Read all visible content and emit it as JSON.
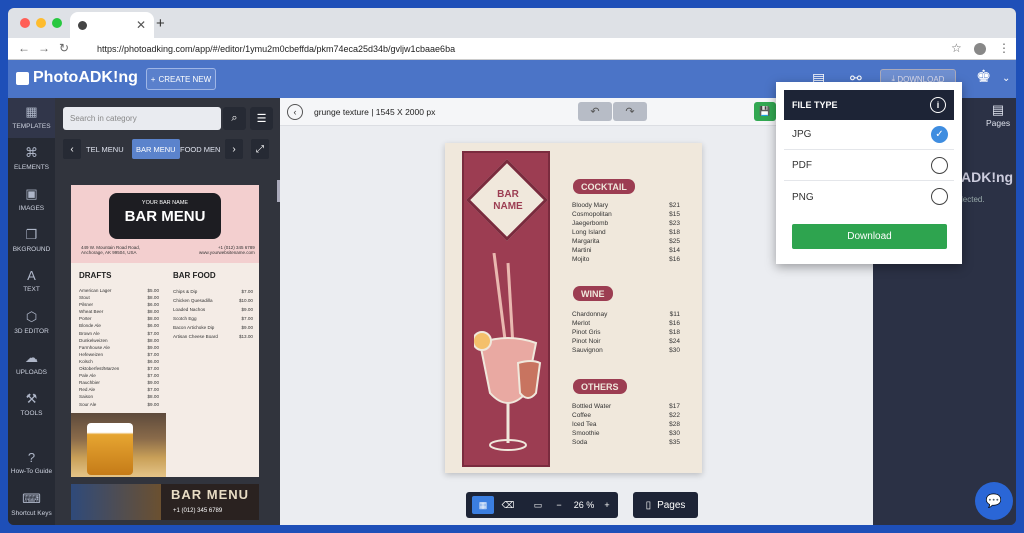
{
  "browser": {
    "tab_title": "",
    "tab_icon": "photoadking-favicon",
    "url": "https://photoadking.com/app/#/editor/1ymu2m0cbeffda/pkm74eca25d34b/gvljw1cbaae6ba"
  },
  "header": {
    "brand": "PhotoADK!ng",
    "create_new": "CREATE NEW",
    "download": "DOWNLOAD"
  },
  "rail": {
    "items": [
      {
        "label": "TEMPLATES",
        "icon": "templates-icon"
      },
      {
        "label": "ELEMENTS",
        "icon": "elements-icon"
      },
      {
        "label": "IMAGES",
        "icon": "images-icon"
      },
      {
        "label": "BKGROUND",
        "icon": "background-icon"
      },
      {
        "label": "TEXT",
        "icon": "text-icon"
      },
      {
        "label": "3D EDITOR",
        "icon": "cube-icon"
      },
      {
        "label": "UPLOADS",
        "icon": "upload-icon"
      },
      {
        "label": "TOOLS",
        "icon": "toolbox-icon"
      },
      {
        "label": "How-To Guide",
        "icon": "question-icon"
      },
      {
        "label": "Shortcut Keys",
        "icon": "keyboard-icon"
      }
    ]
  },
  "panel": {
    "search_placeholder": "Search in category",
    "categories": [
      "TEL MENU",
      "BAR MENU",
      "FOOD MEN"
    ],
    "thumb1": {
      "small": "YOUR BAR NAME",
      "title": "BAR MENU",
      "addr1": "449 W. Mountain Road Road,",
      "addr2": "Anchorage, AK 99504, USA",
      "phone": "+1 (012) 345 6789",
      "web": "www.yourwebsitename.com",
      "col1": "DRAFTS",
      "col2": "BAR FOOD",
      "drafts": [
        "American Lager $5.00",
        "Stout $8.00",
        "Pilsner $6.00",
        "Wheat Beer $8.00",
        "Porter $8.00",
        "Blonde Ale $6.00",
        "Brown Ale $7.00",
        "Dunkelweizen $8.00",
        "Farmhouse Ale $9.00",
        "Hefeweizen $7.00",
        "Kolsch $6.00",
        "Oktoberfest/Marzen $7.00",
        "Pale Ale $7.00",
        "Rauchbier $9.00",
        "Red Ale $7.00",
        "Saison $8.00",
        "Sour Ale $9.00"
      ],
      "food": [
        "Chips & Dip $7.00",
        "Chicken Quesadilla $10.00",
        "Loaded Nachos $9.00",
        "Scotch Egg $7.00",
        "Bacon Artichoke Dip $9.00",
        "Artisan Cheese Board $13.00"
      ]
    },
    "thumb2": {
      "title": "BAR MENU",
      "phone": "+1 (012) 345 6789"
    }
  },
  "canvas": {
    "doc_name": "grunge texture",
    "doc_size": "1545 X 2000 px",
    "zoom": "26 %",
    "pages_label": "Pages"
  },
  "poster": {
    "name1": "BAR",
    "name2": "NAME",
    "sections": [
      {
        "title": "COCKTAIL",
        "items": [
          [
            "Bloody Mary",
            "$21"
          ],
          [
            "Cosmopolitan",
            "$15"
          ],
          [
            "Jaegerbomb",
            "$23"
          ],
          [
            "Long Island",
            "$18"
          ],
          [
            "Margarita",
            "$25"
          ],
          [
            "Martini",
            "$14"
          ],
          [
            "Mojito",
            "$16"
          ]
        ]
      },
      {
        "title": "WINE",
        "items": [
          [
            "Chardonnay",
            "$11"
          ],
          [
            "Merlot",
            "$16"
          ],
          [
            "Pinot Gris",
            "$18"
          ],
          [
            "Pinot Noir",
            "$24"
          ],
          [
            "Sauvignon",
            "$30"
          ]
        ]
      },
      {
        "title": "OTHERS",
        "items": [
          [
            "Bottled Water",
            "$17"
          ],
          [
            "Coffee",
            "$22"
          ],
          [
            "Iced Tea",
            "$28"
          ],
          [
            "Smoothie",
            "$30"
          ],
          [
            "Soda",
            "$35"
          ]
        ]
      }
    ]
  },
  "rightpanel": {
    "pages": "Pages",
    "logo": "ADK!ng",
    "selected": "lected."
  },
  "dropdown": {
    "title": "FILE TYPE",
    "options": [
      {
        "label": "JPG",
        "checked": true
      },
      {
        "label": "PDF",
        "checked": false
      },
      {
        "label": "PNG",
        "checked": false
      }
    ],
    "download": "Download"
  },
  "colors": {
    "brand": "#4b74c7",
    "accent": "#2ea44f",
    "poster": "#9c3d52"
  }
}
